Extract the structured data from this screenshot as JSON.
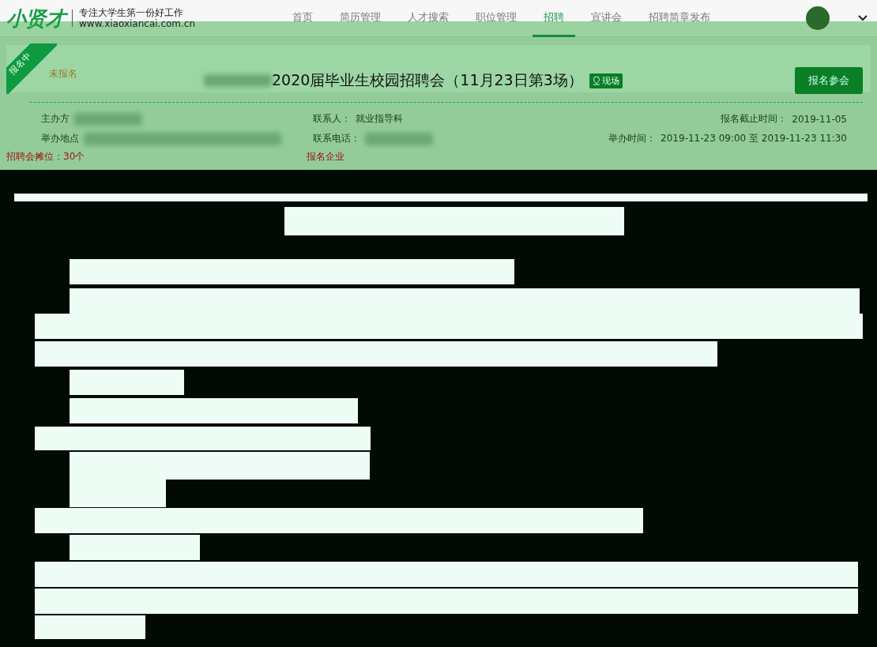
{
  "header": {
    "logo": "小贤才",
    "slogan": "专注大学生第一份好工作",
    "site": "www.xiaoxiancai.com.cn",
    "nav": [
      {
        "label": "首页",
        "selected": false
      },
      {
        "label": "简历管理",
        "selected": false
      },
      {
        "label": "人才搜索",
        "selected": false
      },
      {
        "label": "职位管理",
        "selected": false
      },
      {
        "label": "招聘",
        "selected": true
      },
      {
        "label": "宣讲会",
        "selected": false
      },
      {
        "label": "招聘简章发布",
        "selected": false
      }
    ]
  },
  "event": {
    "ribbon": "报名中",
    "status": "未报名",
    "title": "2020届毕业生校园招聘会（11月23日第3场）",
    "tag": "现场",
    "button": "报名参会",
    "details": [
      {
        "label": "主办方"
      },
      {
        "label": "联系人：",
        "value": "就业指导科"
      },
      {
        "label": "报名截止时间：",
        "value": "2019-11-05"
      },
      {
        "label": "举办地点"
      },
      {
        "label": "联系电话："
      },
      {
        "label": "举办时间：",
        "value": "2019-11-23 09:00 至 2019-11-23 11:30"
      }
    ],
    "booths": "招聘会摊位：30个",
    "registered": "报名企业"
  }
}
